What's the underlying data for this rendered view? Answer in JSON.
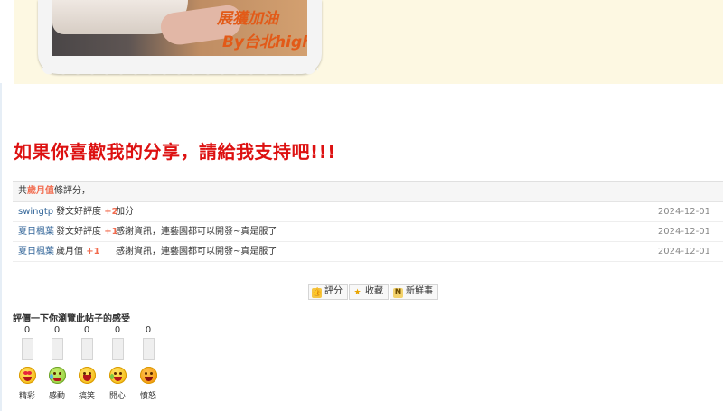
{
  "post_image": {
    "overlay_line1": "展獲加油",
    "overlay_line2": "By台北high"
  },
  "support_heading": "如果你喜歡我的分享，請給我支持吧!!!",
  "rating": {
    "header_prefix": "共",
    "header_highlight": "歲月值",
    "header_suffix": "條評分，",
    "rows": [
      {
        "user": "swingtp",
        "score_label": "發文好評度",
        "points": "+2",
        "reason": "加分",
        "date": "2024-12-01"
      },
      {
        "user": "夏日楓葉",
        "score_label": "發文好評度",
        "points": "+1",
        "reason": "感謝資訊，連藝園都可以開發~真是服了",
        "date": "2024-12-01"
      },
      {
        "user": "夏日楓葉",
        "score_label": "歲月值",
        "points": "+1",
        "reason": "感謝資訊，連藝園都可以開發~真是服了",
        "date": "2024-12-01"
      }
    ]
  },
  "actions": {
    "rate_label": "評分",
    "favorite_label": "收藏",
    "news_label": "新鮮事"
  },
  "moods": {
    "title": "評價一下你瀏覽此帖子的感受",
    "items": [
      {
        "label": "精彩",
        "count": "0",
        "icon": "heart-eyes-face-icon"
      },
      {
        "label": "感動",
        "count": "0",
        "icon": "crying-face-icon"
      },
      {
        "label": "搞笑",
        "count": "0",
        "icon": "laughing-face-icon"
      },
      {
        "label": "開心",
        "count": "0",
        "icon": "happy-face-icon"
      },
      {
        "label": "憤怒",
        "count": "0",
        "icon": "angry-face-icon"
      }
    ]
  },
  "colors": {
    "heading_red": "#dd1111",
    "highlight_orange": "#f26c4f",
    "user_link_blue": "#336699",
    "post_background": "#fdf8e2"
  }
}
